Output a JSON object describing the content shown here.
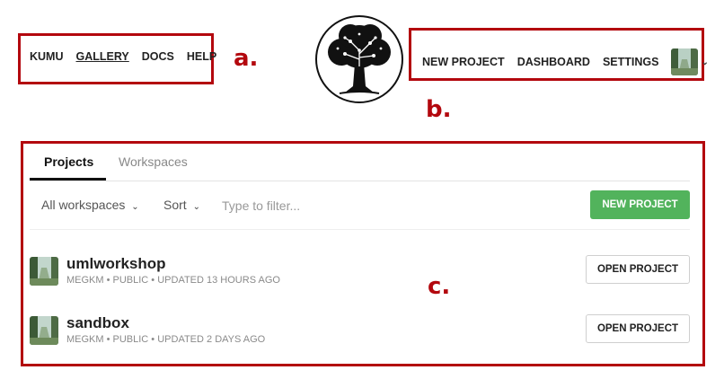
{
  "annotations": {
    "a": "a.",
    "b": "b.",
    "c": "c."
  },
  "top_nav_left": {
    "items": [
      "KUMU",
      "GALLERY",
      "DOCS",
      "HELP"
    ],
    "active": "GALLERY"
  },
  "top_nav_right": {
    "items": [
      "NEW PROJECT",
      "DASHBOARD",
      "SETTINGS"
    ]
  },
  "account_menu": {
    "avatar_icon": "forest-photo",
    "chevron": "⌄"
  },
  "logo": {
    "icon": "tree-logo-icon"
  },
  "tabs": [
    {
      "label": "Projects",
      "active": true
    },
    {
      "label": "Workspaces",
      "active": false
    }
  ],
  "filters": {
    "workspaces_label": "All workspaces",
    "sort_label": "Sort",
    "chevron": "⌄",
    "filter_placeholder": "Type to filter...",
    "filter_value": ""
  },
  "new_project_button": "NEW PROJECT",
  "projects": [
    {
      "name": "umlworkshop",
      "meta": "MEGKM • PUBLIC • UPDATED 13 HOURS AGO",
      "button": "OPEN PROJECT"
    },
    {
      "name": "sandbox",
      "meta": "MEGKM • PUBLIC • UPDATED 2 DAYS AGO",
      "button": "OPEN PROJECT"
    }
  ],
  "colors": {
    "annotation": "#b3080e",
    "primary_button": "#52b35c"
  }
}
